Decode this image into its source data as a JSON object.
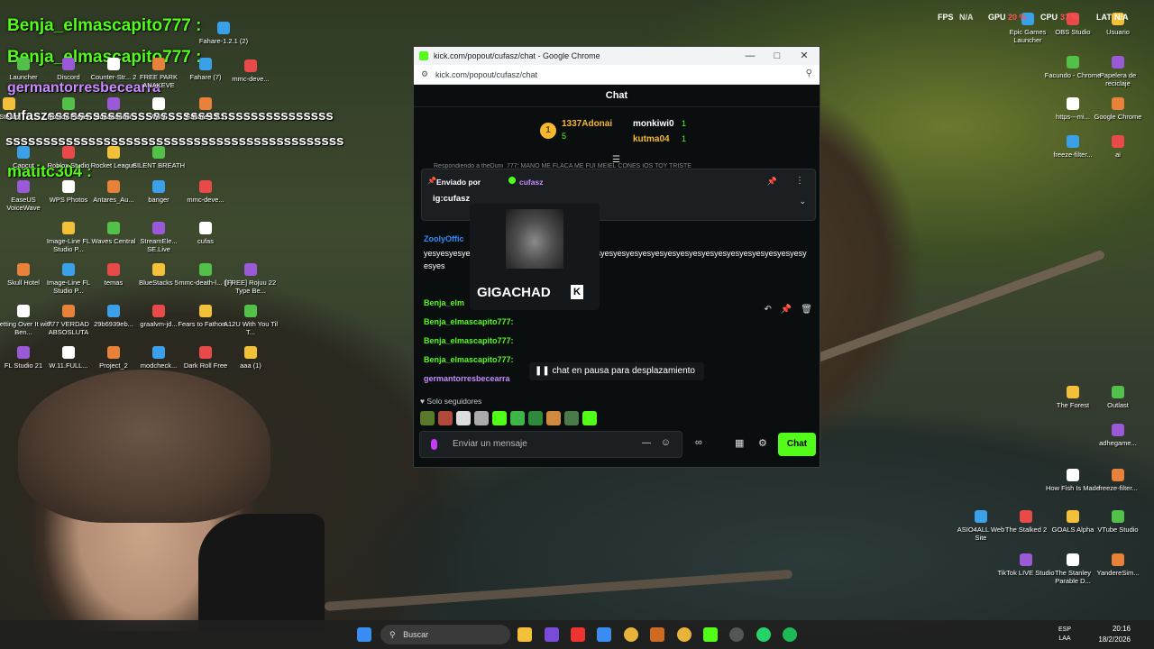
{
  "overlay_chat": [
    {
      "text": "Benja_elmascapito777 :",
      "color": "#53fc18"
    },
    {
      "text": "Benja_elmascapito777 :",
      "color": "#53fc18"
    },
    {
      "text": "germantorresbecearra",
      "color": "#c98bff"
    },
    {
      "text": "cufaszssssssssssssssssssssssssssssssssssssss",
      "color": "#ffffff"
    },
    {
      "text": "sssssssssssssssssssssssssssssssssssssssssssss",
      "color": "#ffffff"
    },
    {
      "text": "matitc304 :",
      "color": "#53fc18"
    }
  ],
  "stats": {
    "fps_label": "FPS",
    "fps_value": "N/A",
    "gpu_label": "GPU",
    "gpu_value": "20 %",
    "cpu_label": "CPU",
    "cpu_value": "37 %",
    "lat_label": "LAT",
    "lat_value": "N/A"
  },
  "desktop_icons_left": [
    "Fahare-1.2.1 (2)",
    "mmc-deve...",
    "Steam",
    "Roblox Player",
    "Juaaaaniiiiii",
    "WIN",
    "Fahare-1.2.1",
    "Capcut",
    "Roblox Studio",
    "Rocket League",
    "SILENT BREATH",
    "EaseUS VoiceWave",
    "WPS Photos",
    "Antares_Au...",
    "banger",
    "mmc-deve...",
    "Image-Line FL Studio P...",
    "Waves Central",
    "StreamEle... SE.Live",
    "cufas",
    "Skull Hotel",
    "Image-Line FL Studio P...",
    "temas",
    "BlueStacks 5",
    "mmc-death-l... (1)",
    "[FREE] Rojuu 22 Type Be...",
    "Getting Over It with Ben...",
    "777 VERDAD ABSOSLUTA",
    "29b6939eb...",
    "graalvm-jd...",
    "Fears to Fathom...",
    "A12U With You Til T...",
    "FL Studio 21",
    "W.11.FULL...",
    "Project_2",
    "modcheck...",
    "Dark Roll Free",
    "aaa (1)",
    "Launcher",
    "Discord",
    "Counter-Str... 2",
    "FREE PARK ANAKEVE",
    "Fahare (7)"
  ],
  "desktop_icons_right": [
    "Epic Games Launcher",
    "OBS Studio",
    "Usuario",
    "Facundo - Chrome",
    "Papelera de reciclaje",
    "https---mi...",
    "Google Chrome",
    "freeze-filter...",
    "ai",
    "The Forest",
    "Outlast",
    "adhegame...",
    "How Fish Is Made",
    "freeze-filter...",
    "ASIO4ALL Web Site",
    "The Stalked 2",
    "GOALS Alpha",
    "VTube Studio",
    "TikTok LIVE Studio",
    "The Stanley Parable D...",
    "YandereSim..."
  ],
  "window": {
    "title": "kick.com/popout/cufasz/chat - Google Chrome",
    "url": "kick.com/popout/cufasz/chat",
    "header": "Chat",
    "leaderboard": {
      "first": {
        "rank": "1",
        "name": "1337Adonai",
        "count": "5"
      },
      "second": {
        "name": "monkiwi0",
        "count": "1"
      },
      "third": {
        "name": "kutma04",
        "count": "1"
      }
    },
    "reply_preview": "Respondiendo a theDuni_777: MANO ME FLACA ME FUI MEIEL CONES IOS TOY TRISTE",
    "pinned": {
      "sent_by_label": "Enviado por",
      "sender": "cufasz",
      "message": "ig:cufasz"
    },
    "messages": [
      {
        "user": "ZoolyOffic",
        "text": "yesyesyesyesyesyesyesyesyesyesyesyesyesyesyesyesyesyesyesyesyesyesyesyesyesyesyesyesyesyesyesyes",
        "color": "#2f8cff"
      },
      {
        "user": "Benja_elm",
        "text": "",
        "color": "#53fc18"
      },
      {
        "user": "Benja_elmascapito777:",
        "text": "",
        "color": "#53fc18"
      },
      {
        "user": "Benja_elmascapito777:",
        "text": "",
        "color": "#53fc18"
      },
      {
        "user": "Benja_elmascapito777:",
        "text": "",
        "color": "#53fc18"
      },
      {
        "user": "germantorresbecearra",
        "text": "",
        "color": "#c98bff"
      }
    ],
    "emote_popup": {
      "name": "GIGACHAD"
    },
    "paused_text": "chat en pausa para desplazamiento",
    "followers_only": "Solo seguidores",
    "input_placeholder": "Enviar un mensaje",
    "send_label": "Chat"
  },
  "taskbar": {
    "search_placeholder": "Buscar",
    "lang": "ESP",
    "lang_sub": "LAA",
    "time": "20:16",
    "date": "18/2/2026"
  },
  "colors": {
    "kick_green": "#53fc18",
    "chat_bg": "#0b0e0f"
  }
}
